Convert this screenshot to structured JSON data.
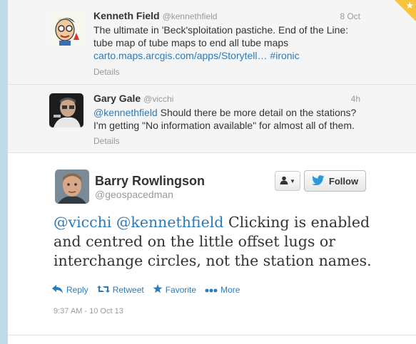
{
  "tweets_above": [
    {
      "name": "Kenneth Field",
      "handle": "@kennethfield",
      "time": "8 Oct",
      "text_line1": "The ultimate in 'Beck'sploitation pastiche. End of the Line:",
      "text_line2": "tube map of tube maps to end all tube maps",
      "link_url": "carto.maps.arcgis.com/apps/Storytell…",
      "hashtag": "#ironic",
      "details": "Details"
    },
    {
      "name": "Gary Gale",
      "handle": "@vicchi",
      "time": "4h",
      "mention": "@kennethfield",
      "text_line1_rest": " Should there be more detail on the stations?",
      "text_line2": "I'm getting \"No information available\" for almost all of them.",
      "details": "Details"
    }
  ],
  "main_tweet": {
    "name": "Barry Rowlingson",
    "handle": "@geospacedman",
    "follow_label": "Follow",
    "mention1": "@vicchi",
    "mention2": "@kennethfield",
    "text_line1_rest": " Clicking is enabled",
    "text_line2": "and centred on the little offset lugs or",
    "text_line3": "interchange circles, not the station names.",
    "timestamp": "9:37 AM - 10 Oct 13",
    "actions": {
      "reply": "Reply",
      "retweet": "Retweet",
      "favorite": "Favorite",
      "more": "More"
    }
  },
  "colors": {
    "link": "#2b7bb9",
    "favorite_corner": "#f9c33a"
  },
  "icons": [
    "star-icon",
    "user-icon",
    "caret-down-icon",
    "twitter-bird-icon",
    "reply-icon",
    "retweet-icon",
    "favorite-star-icon",
    "more-dots-icon"
  ]
}
